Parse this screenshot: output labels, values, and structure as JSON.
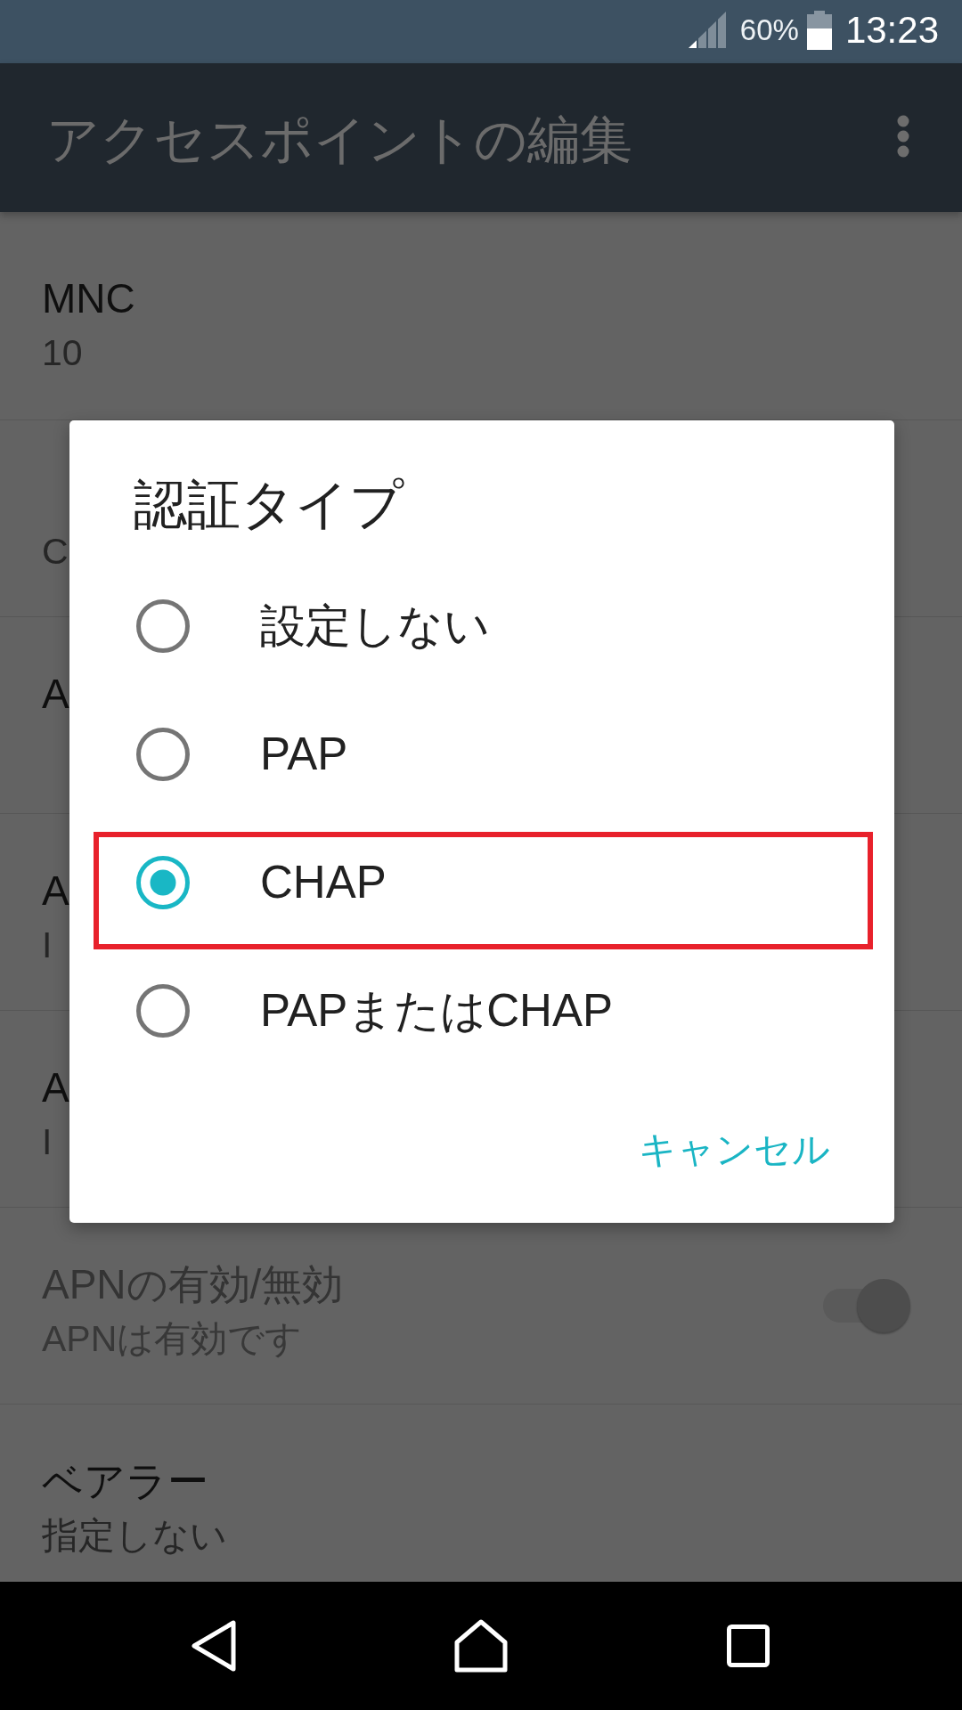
{
  "status_bar": {
    "battery": "60%",
    "time": "13:23"
  },
  "app_bar": {
    "title": "アクセスポイントの編集"
  },
  "settings": [
    {
      "kind": "text",
      "title": "MNC",
      "value": "10",
      "disabled": false
    },
    {
      "kind": "text",
      "value": "C",
      "disabled": false
    },
    {
      "kind": "text",
      "title": "A",
      "disabled": false
    },
    {
      "kind": "text",
      "title": "A",
      "value": "I",
      "disabled": false
    },
    {
      "kind": "text",
      "title": "A",
      "value": "I",
      "disabled": false
    },
    {
      "kind": "toggle",
      "title": "APNの有効/無効",
      "value": "APNは有効です",
      "disabled": true,
      "on": true
    },
    {
      "kind": "text",
      "title": "ベアラー",
      "value": "指定しない",
      "disabled": false
    }
  ],
  "dialog": {
    "title": "認証タイプ",
    "options": [
      {
        "label": "設定しない",
        "selected": false,
        "highlighted": false
      },
      {
        "label": "PAP",
        "selected": false,
        "highlighted": false
      },
      {
        "label": "CHAP",
        "selected": true,
        "highlighted": true
      },
      {
        "label": "PAPまたはCHAP",
        "selected": false,
        "highlighted": false
      }
    ],
    "buttons": [
      "キャンセル"
    ]
  }
}
